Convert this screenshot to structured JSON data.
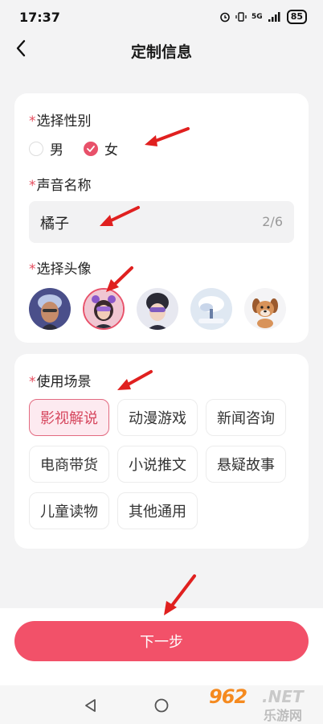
{
  "status_bar": {
    "time": "17:37",
    "network": "5G",
    "battery": "85"
  },
  "header": {
    "title": "定制信息"
  },
  "gender": {
    "required_mark": "*",
    "label": "选择性别",
    "options": [
      {
        "label": "男",
        "selected": false
      },
      {
        "label": "女",
        "selected": true
      }
    ]
  },
  "voice_name": {
    "required_mark": "*",
    "label": "声音名称",
    "value": "橘子",
    "counter": "2/6"
  },
  "avatar": {
    "required_mark": "*",
    "label": "选择头像",
    "selected_index": 1
  },
  "scene": {
    "required_mark": "*",
    "label": "使用场景",
    "options": [
      "影视解说",
      "动漫游戏",
      "新闻咨询",
      "电商带货",
      "小说推文",
      "悬疑故事",
      "儿童读物",
      "其他通用"
    ],
    "selected_index": 0
  },
  "next_button": {
    "label": "下一步"
  },
  "watermark": {
    "number": "962",
    "suffix": ".NET",
    "cn": "乐游网"
  },
  "colors": {
    "accent": "#f25169",
    "arrow": "#e0201f"
  }
}
